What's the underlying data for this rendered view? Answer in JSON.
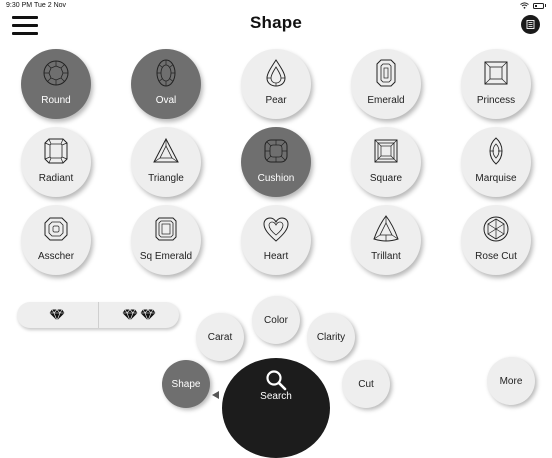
{
  "status_bar": {
    "time": "9:30 PM",
    "date": "Tue 2 Nov"
  },
  "header": {
    "title": "Shape",
    "menu_icon": "hamburger-menu-icon",
    "list_icon": "list-icon"
  },
  "colors": {
    "selected": "#6f6f6f",
    "unselected": "#eeeeee",
    "search": "#1c1c1c"
  },
  "shapes": [
    {
      "label": "Round",
      "icon": "round-diamond-icon",
      "selected": true
    },
    {
      "label": "Oval",
      "icon": "oval-diamond-icon",
      "selected": true
    },
    {
      "label": "Pear",
      "icon": "pear-diamond-icon",
      "selected": false
    },
    {
      "label": "Emerald",
      "icon": "emerald-diamond-icon",
      "selected": false
    },
    {
      "label": "Princess",
      "icon": "princess-diamond-icon",
      "selected": false
    },
    {
      "label": "Radiant",
      "icon": "radiant-diamond-icon",
      "selected": false
    },
    {
      "label": "Triangle",
      "icon": "triangle-diamond-icon",
      "selected": false
    },
    {
      "label": "Cushion",
      "icon": "cushion-diamond-icon",
      "selected": true
    },
    {
      "label": "Square",
      "icon": "square-diamond-icon",
      "selected": false
    },
    {
      "label": "Marquise",
      "icon": "marquise-diamond-icon",
      "selected": false
    },
    {
      "label": "Asscher",
      "icon": "asscher-diamond-icon",
      "selected": false
    },
    {
      "label": "Sq Emerald",
      "icon": "sq-emerald-diamond-icon",
      "selected": false
    },
    {
      "label": "Heart",
      "icon": "heart-diamond-icon",
      "selected": false
    },
    {
      "label": "Trillant",
      "icon": "trillant-diamond-icon",
      "selected": false
    },
    {
      "label": "Rose Cut",
      "icon": "rose-cut-diamond-icon",
      "selected": false
    }
  ],
  "size_toggle": {
    "single_icon": "single-diamond-icon",
    "pair_icon": "pair-diamond-icon"
  },
  "nav": {
    "carat": "Carat",
    "color": "Color",
    "clarity": "Clarity",
    "shape": "Shape",
    "search": "Search",
    "cut": "Cut",
    "more": "More"
  }
}
